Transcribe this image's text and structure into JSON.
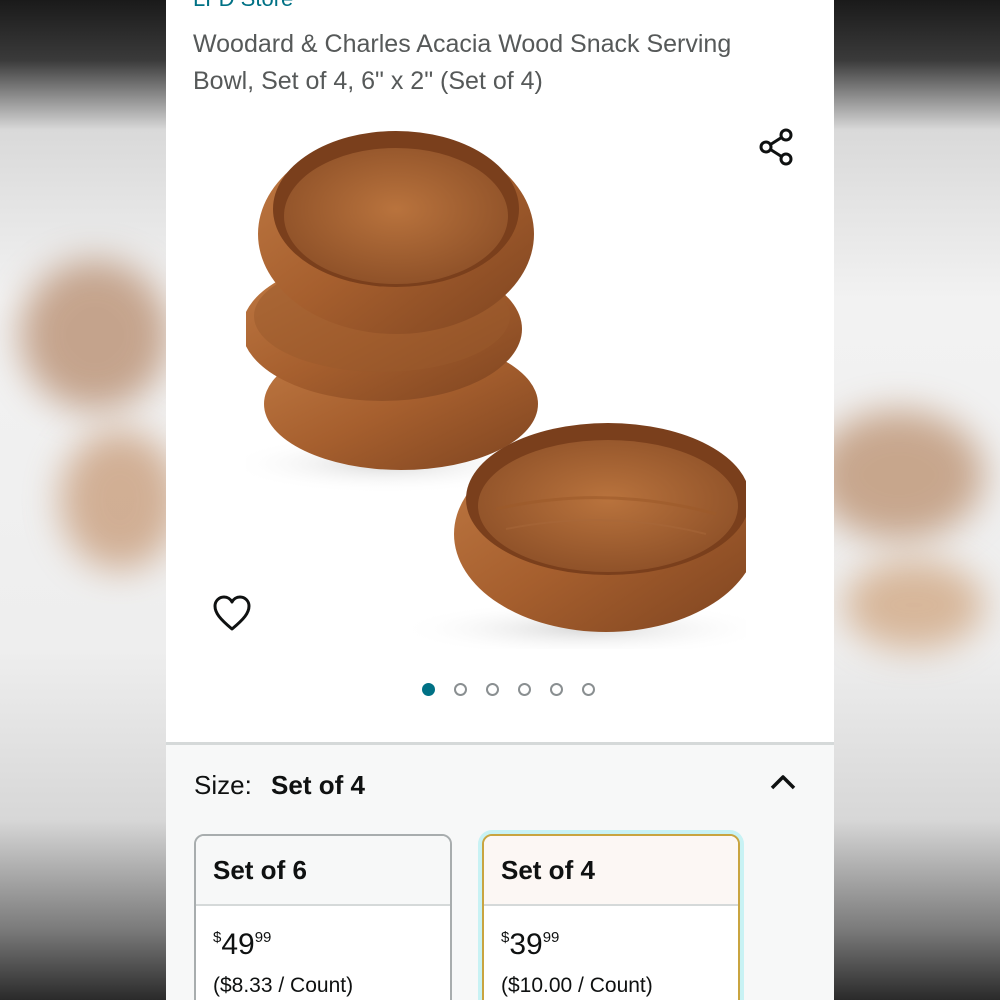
{
  "store": {
    "link_text": "LFD Store"
  },
  "product": {
    "title": "Woodard & Charles Acacia Wood Snack Serving Bowl, Set of 4, 6\" x 2\" (Set of 4)"
  },
  "gallery": {
    "image_count": 6,
    "active_index": 0,
    "share_icon": "share-icon",
    "wishlist_icon": "heart-icon"
  },
  "size_selector": {
    "label": "Size:",
    "selected_value": "Set of 4",
    "toggle_icon": "chevron-up-icon",
    "options": [
      {
        "name": "Set of 6",
        "currency": "$",
        "whole": "49",
        "fraction": "99",
        "per_unit": "($8.33 / Count)",
        "selected": false
      },
      {
        "name": "Set of 4",
        "currency": "$",
        "whole": "39",
        "fraction": "99",
        "per_unit": "($10.00 / Count)",
        "selected": true
      }
    ]
  },
  "colors": {
    "link": "#007185",
    "text": "#0f1111",
    "muted_text": "#565959",
    "selected_border": "#c9a440",
    "selected_glow": "#c8f2f4"
  }
}
